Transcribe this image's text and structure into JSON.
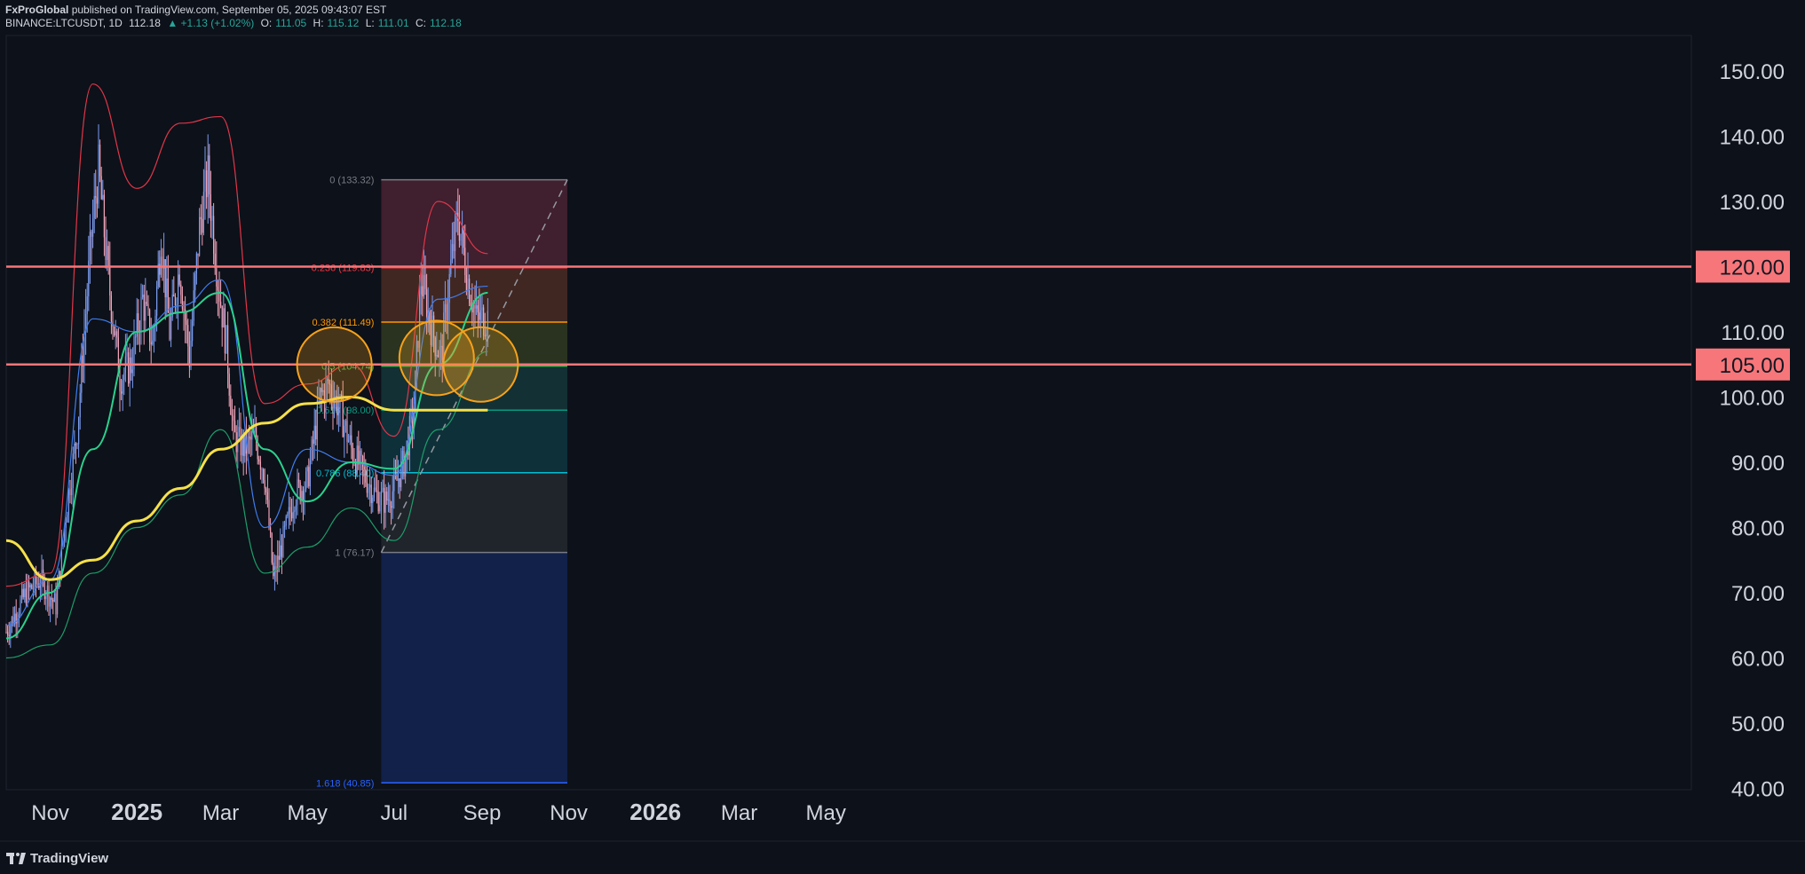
{
  "header": {
    "author": "FxProGlobal",
    "published": "published on TradingView.com, September 05, 2025 09:43:07 EST",
    "symbol": "BINANCE:LTCUSDT, 1D",
    "last": "112.18",
    "change": "▲ +1.13 (+1.02%)",
    "o_label": "O:",
    "o": "111.05",
    "h_label": "H:",
    "h": "115.12",
    "l_label": "L:",
    "l": "111.01",
    "c_label": "C:",
    "c": "112.18"
  },
  "brand": "TradingView",
  "colors": {
    "background": "#0d1119",
    "bull_candle": "#7b9df0",
    "bear_candle": "#f0a3b8",
    "sma200": "#f5e04a",
    "ma_green": "#2bd18d",
    "ma_blue": "#3f7df0",
    "bollinger_upper": "#e0364a",
    "bollinger_lower": "#1c9e6a",
    "horizontal_level": "#f7767a",
    "circle": "#f7a21a"
  },
  "chart_data": {
    "type": "candlestick",
    "symbol": "BINANCE:LTCUSDT",
    "interval": "1D",
    "y_range": [
      40,
      155
    ],
    "y_ticks": [
      "150.00",
      "140.00",
      "130.00",
      "120.00",
      "110.00",
      "100.00",
      "90.00",
      "80.00",
      "70.00",
      "60.00",
      "50.00",
      "40.00"
    ],
    "y_tick_values": [
      150,
      140,
      130,
      120,
      110,
      100,
      90,
      80,
      70,
      60,
      50,
      40
    ],
    "x_ticks": [
      {
        "label": "Nov",
        "bold": false
      },
      {
        "label": "2025",
        "bold": true
      },
      {
        "label": "Mar",
        "bold": false
      },
      {
        "label": "May",
        "bold": false
      },
      {
        "label": "Jul",
        "bold": false
      },
      {
        "label": "Sep",
        "bold": false
      },
      {
        "label": "Nov",
        "bold": false
      },
      {
        "label": "2026",
        "bold": true
      },
      {
        "label": "Mar",
        "bold": false
      },
      {
        "label": "May",
        "bold": false
      }
    ],
    "price_trend": [
      [
        "2024-10-01",
        64
      ],
      [
        "2024-10-15",
        70
      ],
      [
        "2024-10-25",
        72
      ],
      [
        "2024-11-05",
        68
      ],
      [
        "2024-11-12",
        82
      ],
      [
        "2024-11-20",
        95
      ],
      [
        "2024-11-30",
        125
      ],
      [
        "2024-12-05",
        135
      ],
      [
        "2024-12-12",
        118
      ],
      [
        "2024-12-20",
        103
      ],
      [
        "2024-12-28",
        105
      ],
      [
        "2025-01-05",
        115
      ],
      [
        "2025-01-12",
        108
      ],
      [
        "2025-01-18",
        125
      ],
      [
        "2025-01-24",
        110
      ],
      [
        "2025-01-31",
        120
      ],
      [
        "2025-02-07",
        106
      ],
      [
        "2025-02-14",
        126
      ],
      [
        "2025-02-20",
        134
      ],
      [
        "2025-02-27",
        118
      ],
      [
        "2025-03-05",
        108
      ],
      [
        "2025-03-10",
        94
      ],
      [
        "2025-03-18",
        92
      ],
      [
        "2025-03-25",
        94
      ],
      [
        "2025-04-01",
        88
      ],
      [
        "2025-04-07",
        72
      ],
      [
        "2025-04-15",
        79
      ],
      [
        "2025-04-22",
        85
      ],
      [
        "2025-05-01",
        87
      ],
      [
        "2025-05-10",
        100
      ],
      [
        "2025-05-16",
        102
      ],
      [
        "2025-05-24",
        98
      ],
      [
        "2025-06-01",
        92
      ],
      [
        "2025-06-10",
        88
      ],
      [
        "2025-06-18",
        85
      ],
      [
        "2025-06-25",
        84
      ],
      [
        "2025-07-01",
        86
      ],
      [
        "2025-07-08",
        90
      ],
      [
        "2025-07-15",
        98
      ],
      [
        "2025-07-20",
        118
      ],
      [
        "2025-07-28",
        110
      ],
      [
        "2025-08-03",
        106
      ],
      [
        "2025-08-10",
        120
      ],
      [
        "2025-08-15",
        128
      ],
      [
        "2025-08-22",
        118
      ],
      [
        "2025-08-28",
        112
      ],
      [
        "2025-09-05",
        112.18
      ]
    ],
    "sma200": [
      [
        "2024-10-01",
        78
      ],
      [
        "2024-11-01",
        72
      ],
      [
        "2024-12-01",
        75
      ],
      [
        "2025-01-01",
        81
      ],
      [
        "2025-02-01",
        86
      ],
      [
        "2025-03-01",
        92
      ],
      [
        "2025-04-01",
        96
      ],
      [
        "2025-05-01",
        99
      ],
      [
        "2025-06-01",
        100
      ],
      [
        "2025-07-01",
        98
      ],
      [
        "2025-08-01",
        98
      ],
      [
        "2025-09-05",
        98
      ]
    ],
    "ma_green": [
      [
        "2024-10-01",
        63
      ],
      [
        "2024-11-01",
        70
      ],
      [
        "2024-12-01",
        92
      ],
      [
        "2025-01-01",
        110
      ],
      [
        "2025-02-01",
        113
      ],
      [
        "2025-03-01",
        116
      ],
      [
        "2025-04-01",
        92
      ],
      [
        "2025-05-01",
        84
      ],
      [
        "2025-06-01",
        90
      ],
      [
        "2025-07-01",
        89
      ],
      [
        "2025-08-01",
        105
      ],
      [
        "2025-09-05",
        116
      ]
    ],
    "ma_blue": [
      [
        "2024-10-01",
        65
      ],
      [
        "2024-11-01",
        72
      ],
      [
        "2024-12-01",
        112
      ],
      [
        "2025-01-01",
        110
      ],
      [
        "2025-02-01",
        114
      ],
      [
        "2025-03-01",
        118
      ],
      [
        "2025-04-01",
        80
      ],
      [
        "2025-05-01",
        92
      ],
      [
        "2025-06-01",
        90
      ],
      [
        "2025-07-01",
        88
      ],
      [
        "2025-08-01",
        115
      ],
      [
        "2025-09-05",
        117
      ]
    ],
    "bollinger_upper": [
      [
        "2024-10-01",
        71
      ],
      [
        "2024-11-01",
        73
      ],
      [
        "2024-12-01",
        148
      ],
      [
        "2025-01-01",
        132
      ],
      [
        "2025-02-01",
        142
      ],
      [
        "2025-03-01",
        143
      ],
      [
        "2025-04-01",
        99
      ],
      [
        "2025-05-01",
        102
      ],
      [
        "2025-06-01",
        105
      ],
      [
        "2025-07-01",
        94
      ],
      [
        "2025-08-01",
        130
      ],
      [
        "2025-09-05",
        122
      ]
    ],
    "bollinger_lower": [
      [
        "2024-10-01",
        60
      ],
      [
        "2024-11-01",
        62
      ],
      [
        "2024-12-01",
        73
      ],
      [
        "2025-01-01",
        80
      ],
      [
        "2025-02-01",
        85
      ],
      [
        "2025-03-01",
        95
      ],
      [
        "2025-04-01",
        73
      ],
      [
        "2025-05-01",
        77
      ],
      [
        "2025-06-01",
        83
      ],
      [
        "2025-07-01",
        78
      ],
      [
        "2025-08-01",
        95
      ],
      [
        "2025-09-05",
        107
      ]
    ],
    "horizontal_levels": [
      {
        "value": 120,
        "label": "120.00"
      },
      {
        "value": 105,
        "label": "105.00"
      }
    ],
    "fibonacci": {
      "start_date": "2025-06-22",
      "end_date": "2025-10-31",
      "levels": [
        {
          "ratio": "0",
          "price": 133.32,
          "label": "0 (133.32)",
          "line": "#787b86",
          "fill": "#4a2233"
        },
        {
          "ratio": "0.236",
          "price": 119.83,
          "label": "0.236 (119.83)",
          "line": "#f23645",
          "fill": "#4a2c24"
        },
        {
          "ratio": "0.382",
          "price": 111.49,
          "label": "0.382 (111.49)",
          "line": "#ff9800",
          "fill": "#2f3a22"
        },
        {
          "ratio": "0.5",
          "price": 104.74,
          "label": "0.5 (104.74)",
          "line": "#4caf50",
          "fill": "#15363a"
        },
        {
          "ratio": "0.618",
          "price": 98.0,
          "label": "0.618 (98.00)",
          "line": "#089981",
          "fill": "#0f3640"
        },
        {
          "ratio": "0.786",
          "price": 88.4,
          "label": "0.786 (88.40)",
          "line": "#00bcd4",
          "fill": "#24282f"
        },
        {
          "ratio": "1",
          "price": 76.17,
          "label": "1 (76.17)",
          "line": "#787b86",
          "fill": "#132552"
        },
        {
          "ratio": "1.618",
          "price": 40.85,
          "label": "1.618 (40.85)",
          "line": "#2962ff",
          "fill": "#2a1f3a"
        }
      ]
    },
    "trendline": {
      "from": [
        "2025-06-22",
        76.17
      ],
      "to": [
        "2025-10-31",
        133.32
      ]
    },
    "circles": [
      {
        "date": "2025-05-20",
        "price": 105
      },
      {
        "date": "2025-07-31",
        "price": 106
      },
      {
        "date": "2025-08-31",
        "price": 105
      }
    ]
  }
}
